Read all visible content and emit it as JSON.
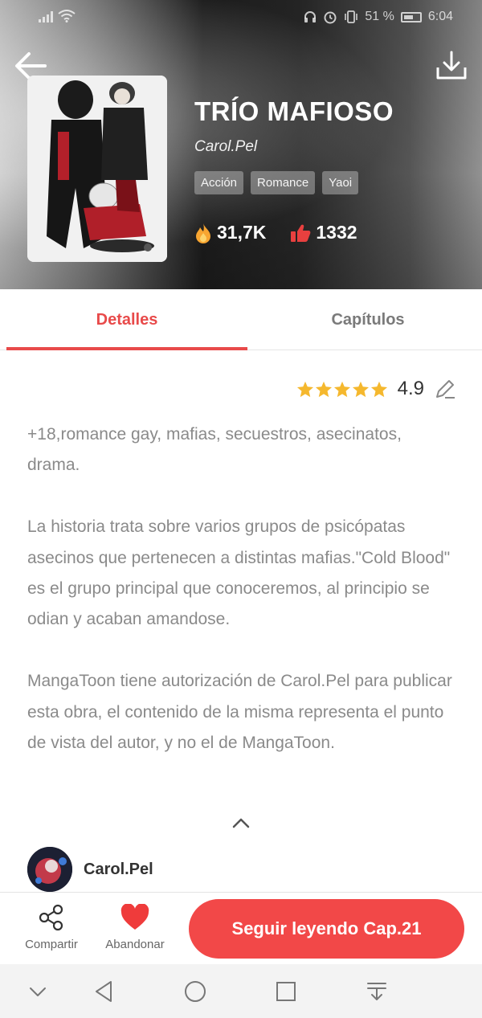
{
  "status_bar": {
    "battery_pct": "51 %",
    "time": "6:04"
  },
  "book": {
    "title": "TRÍO MAFIOSO",
    "author": "Carol.Pel",
    "tags": [
      "Acción",
      "Romance",
      "Yaoi"
    ],
    "views": "31,7K",
    "likes": "1332"
  },
  "tabs": {
    "details_label": "Detalles",
    "chapters_label": "Capítulos",
    "active": "Detalles"
  },
  "rating": {
    "value": "4.9",
    "stars_filled": 5,
    "stars_total": 5
  },
  "description": {
    "paragraphs": [
      "+18,romance gay, mafias, secuestros, asecinatos, drama.",
      "La historia trata sobre varios grupos de psicópatas asecinos que pertenecen a distintas mafias.\"Cold Blood\" es el grupo principal que conoceremos, al principio se odian y acaban amandose.",
      "MangaToon tiene autorización de Carol.Pel para publicar esta obra, el contenido de la misma representa el punto de vista del autor, y no el de MangaToon."
    ]
  },
  "author_row": {
    "name": "Carol.Pel"
  },
  "actions": {
    "share_label": "Compartir",
    "leave_label": "Abandonar",
    "continue_label": "Seguir leyendo Cap.21"
  },
  "colors": {
    "accent": "#e84a4a",
    "button": "#f24848",
    "star": "#f5b82e"
  },
  "icons": {
    "back": "arrow-left-icon",
    "download": "download-icon",
    "fire": "fire-icon",
    "thumbs_up": "thumbs-up-icon",
    "edit": "pencil-icon",
    "collapse": "chevron-up-icon",
    "share": "share-icon",
    "heart": "heart-icon"
  }
}
